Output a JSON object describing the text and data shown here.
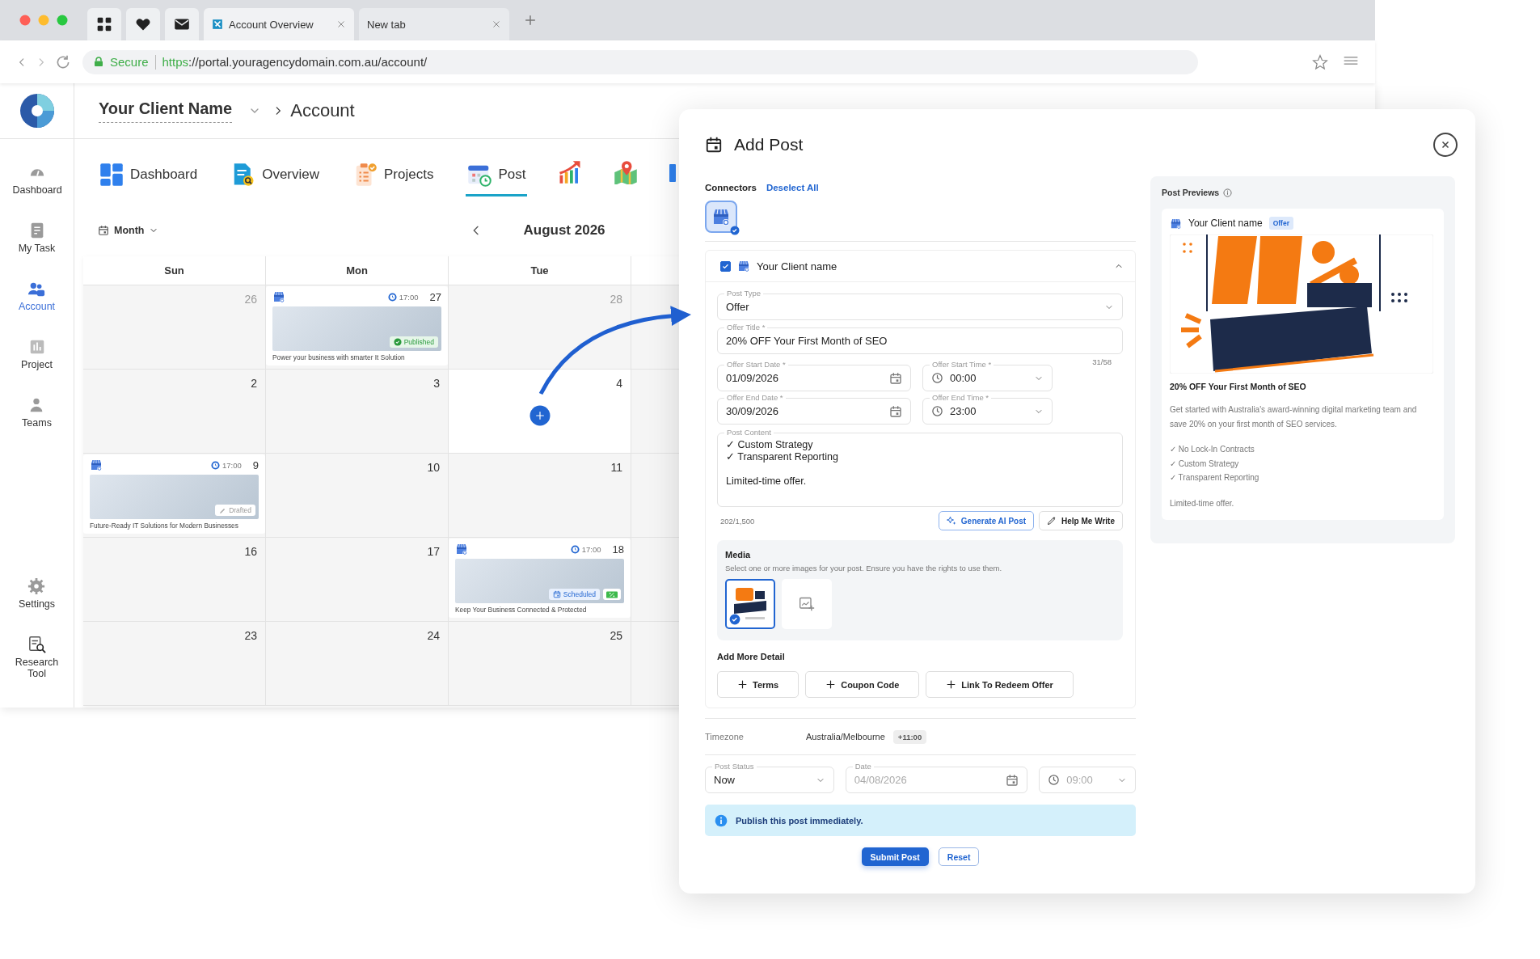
{
  "browser": {
    "tabs": [
      {
        "label": "Account Overview",
        "selected": true
      },
      {
        "label": "New tab",
        "selected": false
      }
    ],
    "secure_label": "Secure",
    "url_scheme": "https",
    "url_rest": "://portal.youragencydomain.com.au/account/"
  },
  "header": {
    "client_name": "Your Client Name",
    "breadcrumb": "Account"
  },
  "sidebar": {
    "items": [
      {
        "label": "Dashboard",
        "kind": "gauge",
        "selected": false
      },
      {
        "label": "My Task",
        "kind": "task",
        "selected": false
      },
      {
        "label": "Account",
        "kind": "account",
        "selected": true
      },
      {
        "label": "Project",
        "kind": "project",
        "selected": false
      },
      {
        "label": "Teams",
        "kind": "team",
        "selected": false
      }
    ],
    "bottom_items": [
      {
        "label": "Settings",
        "kind": "settings",
        "selected": false
      },
      {
        "label": "Research Tool",
        "kind": "research",
        "selected": false
      }
    ]
  },
  "nav_tabs": [
    {
      "label": "Dashboard",
      "kind": "dashboard",
      "selected": false
    },
    {
      "label": "Overview",
      "kind": "overview",
      "selected": false
    },
    {
      "label": "Projects",
      "kind": "projects",
      "selected": false
    },
    {
      "label": "Post",
      "kind": "post",
      "selected": true
    }
  ],
  "calendar": {
    "view": "Month",
    "title": "August 2026",
    "weekdays": [
      "Sun",
      "Mon",
      "Tue"
    ],
    "weeks": [
      [
        {
          "day": "26",
          "dimmed": true,
          "selected": false
        },
        {
          "day": "27",
          "dimmed": false,
          "selected": false,
          "post": {
            "time": "17:00",
            "status": "Published",
            "kind": "published",
            "caption": "Power your business with smarter It Solution",
            "offer": false
          }
        },
        {
          "day": "28",
          "dimmed": true,
          "selected": false
        }
      ],
      [
        {
          "day": "2",
          "dimmed": false,
          "selected": false
        },
        {
          "day": "3",
          "dimmed": false,
          "selected": false
        },
        {
          "day": "4",
          "dimmed": false,
          "selected": true
        }
      ],
      [
        {
          "day": "9",
          "dimmed": false,
          "selected": false,
          "post": {
            "time": "17:00",
            "status": "Drafted",
            "kind": "drafted",
            "caption": "Future-Ready IT Solutions for Modern Businesses",
            "offer": false
          }
        },
        {
          "day": "10",
          "dimmed": false,
          "selected": false
        },
        {
          "day": "11",
          "dimmed": false,
          "selected": false
        }
      ],
      [
        {
          "day": "16",
          "dimmed": false,
          "selected": false
        },
        {
          "day": "17",
          "dimmed": false,
          "selected": false
        },
        {
          "day": "18",
          "dimmed": false,
          "selected": false,
          "post": {
            "time": "17:00",
            "status": "Scheduled",
            "kind": "scheduled",
            "caption": "Keep Your Business Connected & Protected",
            "offer": true
          }
        }
      ],
      [
        {
          "day": "23",
          "dimmed": false,
          "selected": false
        },
        {
          "day": "24",
          "dimmed": false,
          "selected": false
        },
        {
          "day": "25",
          "dimmed": false,
          "selected": false
        }
      ]
    ]
  },
  "modal": {
    "title": "Add Post",
    "connectors_label": "Connectors",
    "deselect_all": "Deselect All",
    "connector_selected": true,
    "account": {
      "name": "Your Client name",
      "checked": true,
      "expanded": true
    },
    "post_type": {
      "label": "Post Type",
      "value": "Offer"
    },
    "offer_title": {
      "label": "Offer Title *",
      "value": "20% OFF Your First Month of SEO",
      "counter": "31/58"
    },
    "start_date": {
      "label": "Offer Start Date *",
      "value": "01/09/2026"
    },
    "start_time": {
      "label": "Offer Start Time *",
      "value": "00:00"
    },
    "end_date": {
      "label": "Offer End Date *",
      "value": "30/09/2026"
    },
    "end_time": {
      "label": "Offer End Time *",
      "value": "23:00"
    },
    "content": {
      "label": "Post Content",
      "value": "✓ Custom Strategy\n✓ Transparent Reporting\n\nLimited-time offer.",
      "counter": "202/1,500"
    },
    "generate_button": "Generate AI Post",
    "help_button": "Help Me Write",
    "media": {
      "title": "Media",
      "hint": "Select one or more images for your post. Ensure you have the rights to use them.",
      "images": [
        {
          "selected": true
        }
      ]
    },
    "add_more": {
      "title": "Add More Detail",
      "buttons": [
        "Terms",
        "Coupon Code",
        "Link To Redeem Offer"
      ]
    },
    "timezone": {
      "label": "Timezone",
      "value": "Australia/Melbourne",
      "offset": "+11:00"
    },
    "post_status": {
      "label": "Post Status",
      "value": "Now"
    },
    "date": {
      "label": "Date",
      "value": "04/08/2026",
      "disabled": true
    },
    "time": {
      "value": "09:00",
      "disabled": true
    },
    "info": "Publish this post immediately.",
    "submit": "Submit Post",
    "reset": "Reset"
  },
  "preview": {
    "title": "Post Previews",
    "account": "Your Client name",
    "badge": "Offer",
    "headline": "20% OFF Your First Month of SEO",
    "paragraphs": [
      "Get started with Australia's award-winning digital marketing team and save 20% on your first month of SEO services.",
      "✓ No Lock-In Contracts\n✓ Custom Strategy\n✓ Transparent Reporting",
      "Limited-time offer."
    ]
  }
}
